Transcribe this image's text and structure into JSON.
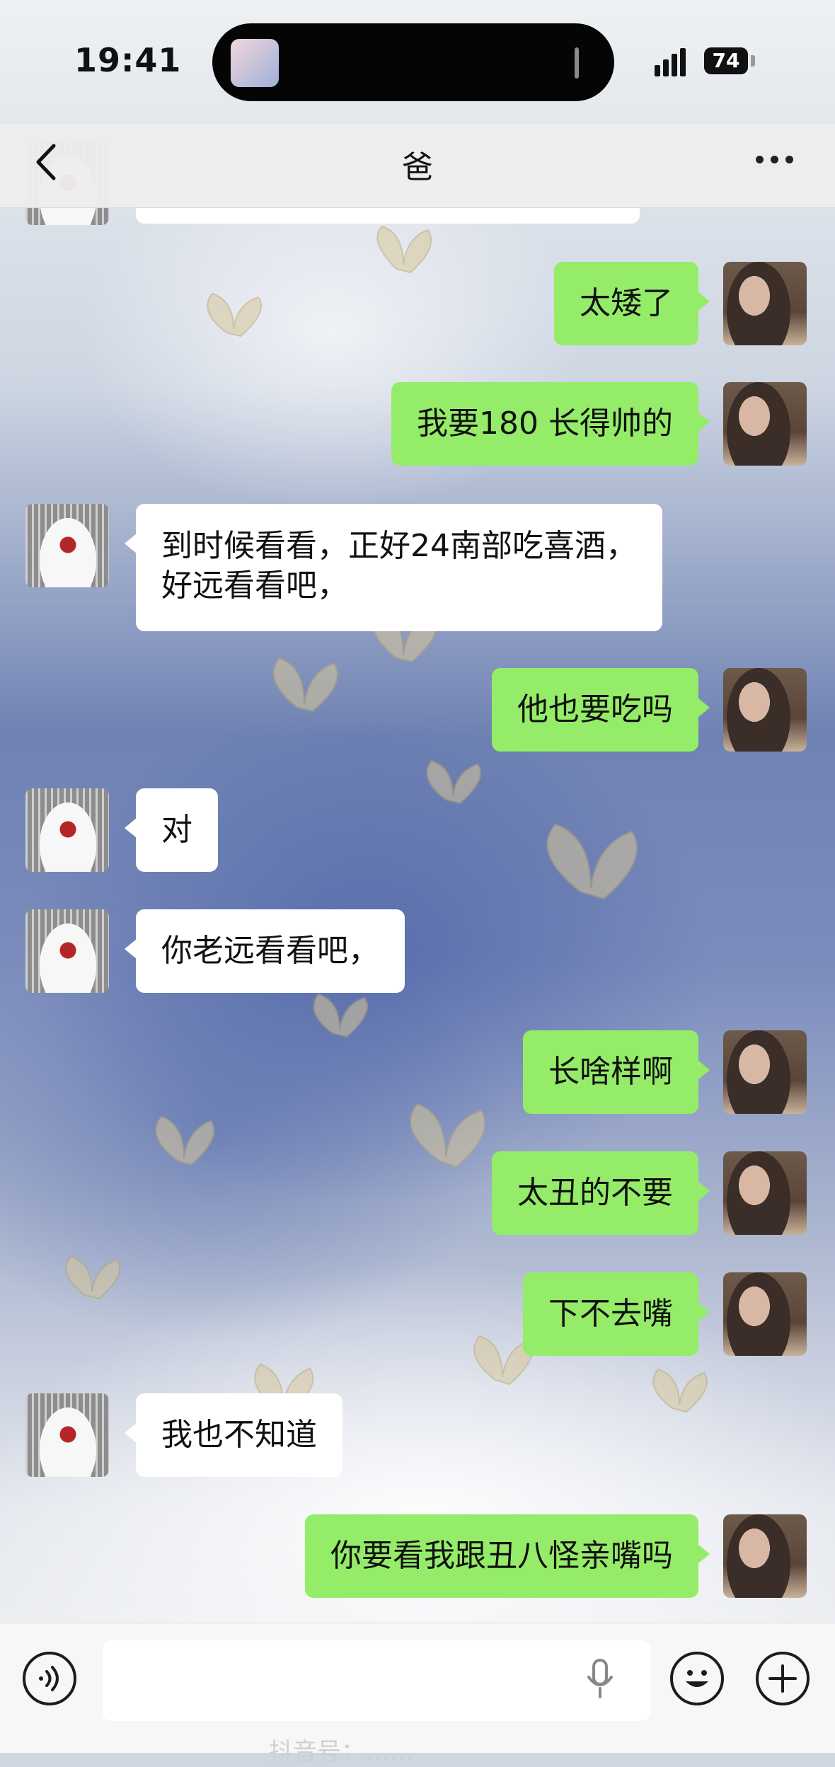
{
  "status_bar": {
    "time": "19:41",
    "battery": "74"
  },
  "nav": {
    "title": "爸"
  },
  "messages": [
    {
      "side": "out",
      "lines": [
        "太矮了"
      ]
    },
    {
      "side": "out",
      "lines": [
        "我要180 长得帅的"
      ]
    },
    {
      "side": "in",
      "lines": [
        "到时候看看，正好24南部吃喜酒，",
        "好远看看吧，"
      ]
    },
    {
      "side": "out",
      "lines": [
        "他也要吃吗"
      ]
    },
    {
      "side": "in",
      "lines": [
        "对"
      ]
    },
    {
      "side": "in",
      "lines": [
        "你老远看看吧，"
      ]
    },
    {
      "side": "out",
      "lines": [
        "长啥样啊"
      ]
    },
    {
      "side": "out",
      "lines": [
        "太丑的不要"
      ]
    },
    {
      "side": "out",
      "lines": [
        "下不去嘴"
      ]
    },
    {
      "side": "in",
      "lines": [
        "我也不知道"
      ]
    },
    {
      "side": "out",
      "lines": [
        "你要看我跟丑八怪亲嘴吗"
      ]
    }
  ],
  "input_bar": {
    "value": ""
  },
  "watermark": "抖音号：……",
  "icons": [
    "back-icon",
    "more-icon",
    "voice-icon",
    "mic-icon",
    "emoji-icon",
    "plus-icon"
  ]
}
